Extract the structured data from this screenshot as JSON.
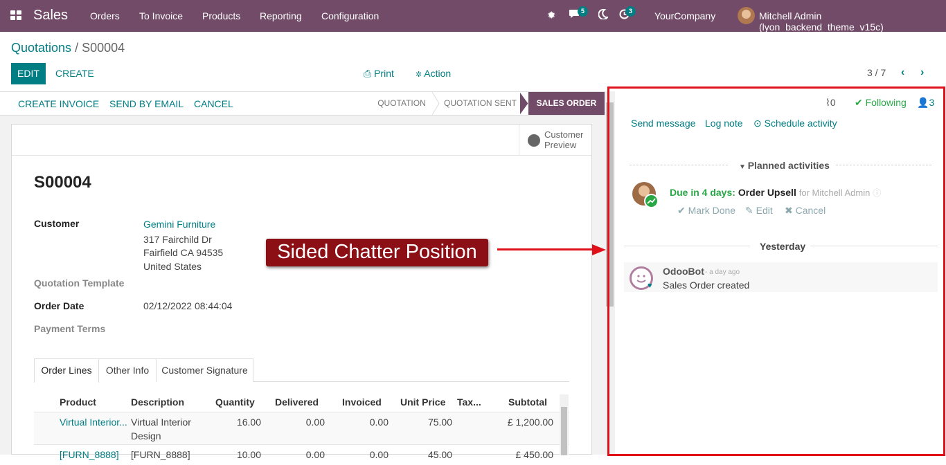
{
  "topbar": {
    "app_name": "Sales",
    "menu": [
      "Orders",
      "To Invoice",
      "Products",
      "Reporting",
      "Configuration"
    ],
    "icons": [
      "bug-icon",
      "chat-icon",
      "moon-icon",
      "activity-clock-icon"
    ],
    "chat_count": "5",
    "activity_count": "3",
    "company": "YourCompany",
    "user": "Mitchell Admin (lyon_backend_theme_v15c)"
  },
  "breadcrumb": {
    "parent": "Quotations",
    "separator": " / ",
    "current": "S00004"
  },
  "control": {
    "edit": "EDIT",
    "create": "CREATE",
    "print": "Print",
    "action": "Action",
    "pager": "3 / 7"
  },
  "statusbar": {
    "buttons": [
      "CREATE INVOICE",
      "SEND BY EMAIL",
      "CANCEL"
    ],
    "stages": [
      "QUOTATION",
      "QUOTATION SENT",
      "SALES ORDER"
    ],
    "active_stage": "SALES ORDER"
  },
  "form": {
    "customer_preview": [
      "Customer",
      "Preview"
    ],
    "reference": "S00004",
    "customer_label": "Customer",
    "customer_name": "Gemini Furniture",
    "address": [
      "317 Fairchild Dr",
      "Fairfield CA 94535",
      "United States"
    ],
    "quotation_template_label": "Quotation Template",
    "order_date_label": "Order Date",
    "order_date": "02/12/2022 08:44:04",
    "payment_terms_label": "Payment Terms",
    "tabs": [
      "Order Lines",
      "Other Info",
      "Customer Signature"
    ],
    "columns": [
      "Product",
      "Description",
      "Quantity",
      "Delivered",
      "Invoiced",
      "Unit Price",
      "Tax...",
      "Subtotal"
    ],
    "rows": [
      {
        "product": "Virtual Interior...",
        "description": [
          "Virtual Interior",
          "Design"
        ],
        "quantity": "16.00",
        "delivered": "0.00",
        "invoiced": "0.00",
        "unit_price": "75.00",
        "subtotal": "£ 1,200.00"
      },
      {
        "product": "[FURN_8888]",
        "description": [
          "[FURN_8888]"
        ],
        "quantity": "10.00",
        "delivered": "0.00",
        "invoiced": "0.00",
        "unit_price": "45.00",
        "subtotal": "£ 450.00"
      }
    ]
  },
  "chatter": {
    "attachments": "0",
    "following": "Following",
    "followers": "3",
    "send_message": "Send message",
    "log_note": "Log note",
    "schedule_activity": "Schedule activity",
    "planned_title": "Planned activities",
    "activity": {
      "due": "Due in 4 days:",
      "title": "Order Upsell",
      "assignee": "for Mitchell Admin",
      "mark_done": "Mark Done",
      "edit": "Edit",
      "cancel": "Cancel"
    },
    "date_separator": "Yesterday",
    "message": {
      "author": "OdooBot",
      "time": "- a day ago",
      "body": "Sales Order created"
    }
  },
  "annotation": {
    "text": "Sided Chatter Position",
    "color": "#e0101a"
  },
  "colors": {
    "brand": "#714b67",
    "accent": "#017e84",
    "success": "#28a745"
  }
}
